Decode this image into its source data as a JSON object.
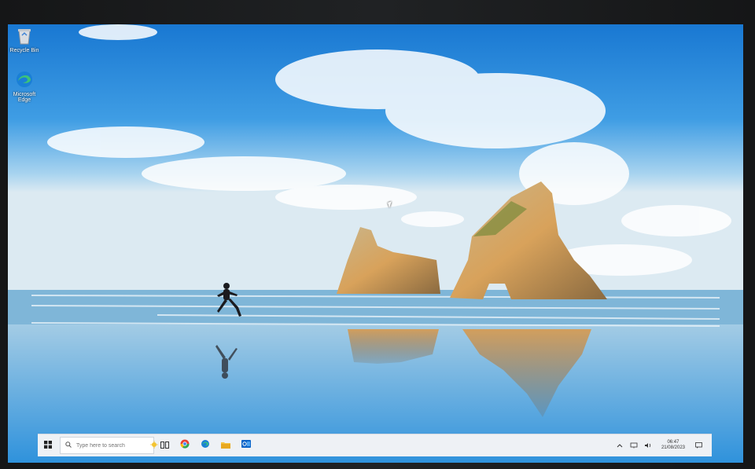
{
  "desktop": {
    "icons": [
      {
        "label": "Recycle Bin"
      },
      {
        "label": "Microsoft Edge"
      }
    ]
  },
  "taskbar": {
    "search": {
      "placeholder": "Type here to search"
    },
    "clock": {
      "time": "06:47",
      "date": "21/08/2023"
    }
  },
  "colors": {
    "taskbar_bg": "#eef1f5",
    "edge_blue": "#1a7fd6",
    "edge_green": "#3cc27a"
  }
}
